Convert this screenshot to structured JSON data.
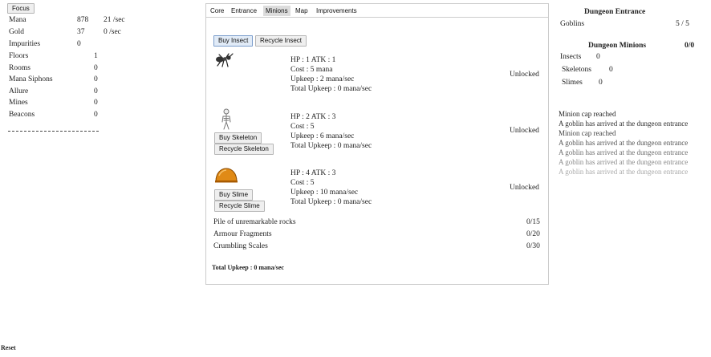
{
  "left": {
    "focus_label": "Focus",
    "resources": [
      {
        "label": "Mana",
        "value": "878",
        "rate": "21 /sec"
      },
      {
        "label": "Gold",
        "value": "37",
        "rate": "0 /sec"
      },
      {
        "label": "Impurities",
        "value": "0",
        "rate": ""
      }
    ],
    "buildings": [
      {
        "label": "Floors",
        "value": "1"
      },
      {
        "label": "Rooms",
        "value": "0"
      },
      {
        "label": "Mana Siphons",
        "value": "0"
      },
      {
        "label": "Allure",
        "value": "0"
      },
      {
        "label": "Mines",
        "value": "0"
      },
      {
        "label": "Beacons",
        "value": "0"
      }
    ],
    "divider": "-------------------------------",
    "reset_label": "Reset"
  },
  "tabs": [
    "Core",
    "Entrance",
    "Minions",
    "Map",
    "Improvements"
  ],
  "active_tab": "Minions",
  "minions": {
    "top_buttons": [
      "Buy Insect",
      "Recycle Insect"
    ],
    "list": [
      {
        "icon": "ant-icon",
        "hp_atk": "HP : 1 ATK : 1",
        "cost": "Cost : 5 mana",
        "upkeep": "Upkeep : 2 mana/sec",
        "total_upkeep": "Total Upkeep : 0 mana/sec",
        "status": "Unlocked",
        "buttons": []
      },
      {
        "icon": "skeleton-icon",
        "hp_atk": "HP : 2 ATK : 3",
        "cost": "Cost : 5",
        "upkeep": "Upkeep : 6 mana/sec",
        "total_upkeep": "Total Upkeep : 0 mana/sec",
        "status": "Unlocked",
        "buttons": [
          "Buy Skeleton",
          "Recycle Skeleton"
        ]
      },
      {
        "icon": "slime-icon",
        "hp_atk": "HP : 4 ATK : 3",
        "cost": "Cost : 5",
        "upkeep": "Upkeep : 10 mana/sec",
        "total_upkeep": "Total Upkeep : 0 mana/sec",
        "status": "Unlocked",
        "buttons": [
          "Buy Slime",
          "Recycle Slime"
        ]
      }
    ],
    "materials": [
      {
        "label": "Pile of unremarkable rocks",
        "value": "0/15"
      },
      {
        "label": "Armour Fragments",
        "value": "0/20"
      },
      {
        "label": "Crumbling Scales",
        "value": "0/30"
      }
    ],
    "total_upkeep": "Total Upkeep : 0 mana/sec"
  },
  "right": {
    "entrance_title": "Dungeon Entrance",
    "goblins_label": "Goblins",
    "goblins_value": "5 / 5",
    "minions_title": "Dungeon Minions",
    "minions_total": "0/0",
    "minion_counts": [
      {
        "label": "Insects",
        "value": "0"
      },
      {
        "label": "Skeletons",
        "value": "0"
      },
      {
        "label": "Slimes",
        "value": "0"
      }
    ],
    "log": [
      "Minion cap reached",
      "A goblin has arrived at the dungeon entrance",
      "Minion cap reached",
      "A goblin has arrived at the dungeon entrance",
      "A goblin has arrived at the dungeon entrance",
      "A goblin has arrived at the dungeon entrance",
      "A goblin has arrived at the dungeon entrance"
    ]
  }
}
